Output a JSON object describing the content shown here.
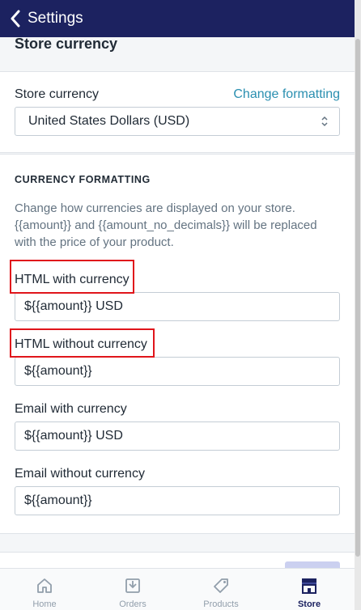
{
  "header": {
    "back_label": "Settings"
  },
  "page": {
    "title": "Store currency"
  },
  "currency_card": {
    "label": "Store currency",
    "link": "Change formatting",
    "selected": "United States Dollars (USD)"
  },
  "formatting": {
    "heading": "CURRENCY FORMATTING",
    "help": "Change how currencies are displayed on your store. {{amount}} and {{amount_no_decimals}} will be replaced with the price of your product.",
    "html_with_label": "HTML with currency",
    "html_with_value": "${{amount}} USD",
    "html_without_label": "HTML without currency",
    "html_without_value": "${{amount}}",
    "email_with_label": "Email with currency",
    "email_with_value": "${{amount}} USD",
    "email_without_label": "Email without currency",
    "email_without_value": "${{amount}}"
  },
  "tabs": [
    {
      "label": "Home",
      "icon": "home-icon"
    },
    {
      "label": "Orders",
      "icon": "orders-icon"
    },
    {
      "label": "Products",
      "icon": "products-icon"
    },
    {
      "label": "Store",
      "icon": "store-icon",
      "active": true
    }
  ],
  "colors": {
    "header": "#1c2260",
    "link": "#2a8fb0",
    "highlight": "#e0151b",
    "active_tab": "#1c2260"
  }
}
